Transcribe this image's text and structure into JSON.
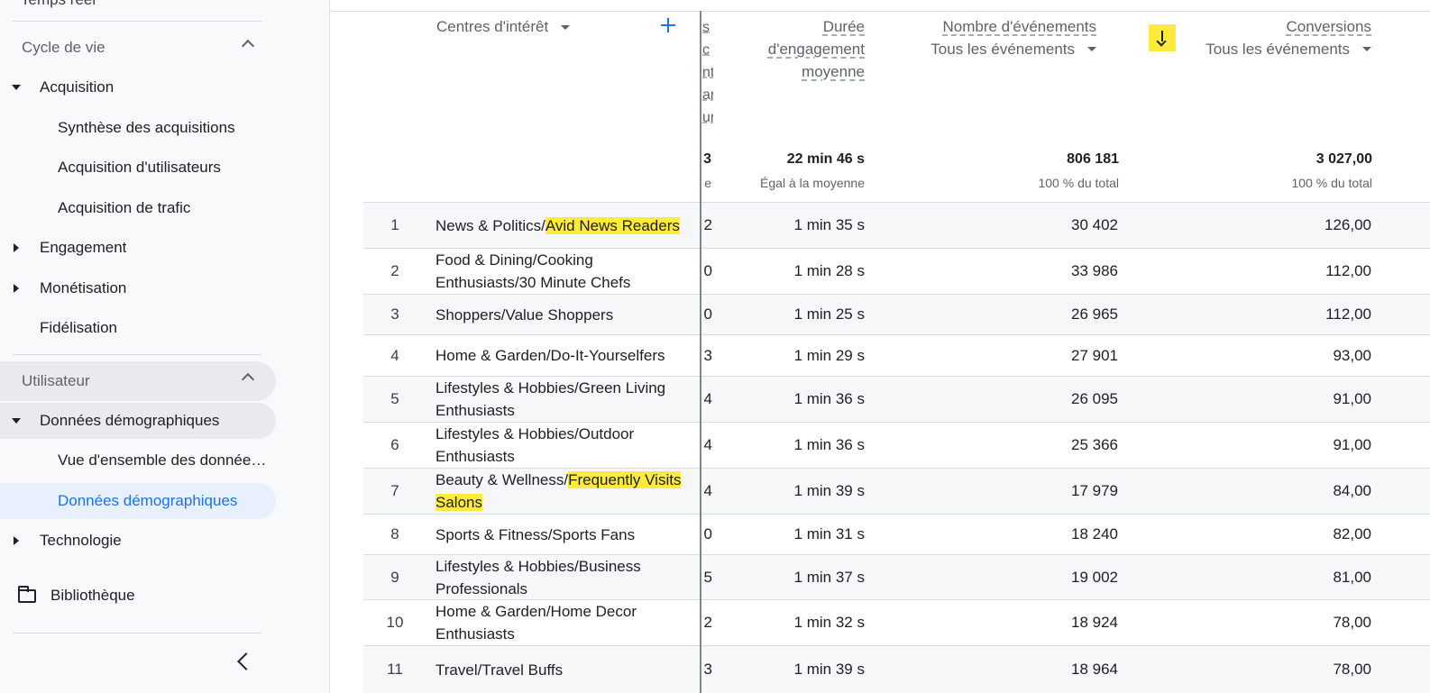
{
  "sidebar": {
    "cut_top_label": "Temps réel",
    "section_lifecycle": "Cycle de vie",
    "acquisition": "Acquisition",
    "acq_overview": "Synthèse des acquisitions",
    "acq_users": "Acquisition d'utilisateurs",
    "acq_traffic": "Acquisition de trafic",
    "engagement": "Engagement",
    "monetization": "Monétisation",
    "retention": "Fidélisation",
    "section_user": "Utilisateur",
    "demographics": "Données démographiques",
    "demo_overview": "Vue d'ensemble des données démographiques",
    "demo_details": "Données démographiques",
    "technology": "Technologie",
    "library": "Bibliothèque"
  },
  "table": {
    "dimension_header": "Centres d'intérêt",
    "cut_header": [
      "s",
      "c",
      "nt",
      "ar",
      "ur"
    ],
    "eng_header": [
      "Durée",
      "d'engagement",
      "moyenne"
    ],
    "events_header": "Nombre d'événements",
    "events_filter": "Tous les événements",
    "conv_header": "Conversions",
    "conv_filter": "Tous les événements",
    "totals": {
      "cut": "3",
      "cut_sub": "e",
      "eng": "22 min 46 s",
      "eng_sub": "Égal à la moyenne",
      "events": "806 181",
      "events_sub": "100 % du total",
      "conv": "3 027,00",
      "conv_sub": "100 % du total"
    },
    "rows": [
      {
        "idx": "1",
        "name": "News & Politics/",
        "hl": "Avid News Readers",
        "cut": "2",
        "eng": "1 min 35 s",
        "events": "30 402",
        "conv": "126,00"
      },
      {
        "idx": "2",
        "name": "Food & Dining/Cooking Enthusiasts/30 Minute Chefs",
        "hl": "",
        "cut": "0",
        "eng": "1 min 28 s",
        "events": "33 986",
        "conv": "112,00"
      },
      {
        "idx": "3",
        "name": "Shoppers/Value Shoppers",
        "hl": "",
        "cut": "0",
        "eng": "1 min 25 s",
        "events": "26 965",
        "conv": "112,00"
      },
      {
        "idx": "4",
        "name": "Home & Garden/Do-It-Yourselfers",
        "hl": "",
        "cut": "3",
        "eng": "1 min 29 s",
        "events": "27 901",
        "conv": "93,00"
      },
      {
        "idx": "5",
        "name": "Lifestyles & Hobbies/Green Living Enthusiasts",
        "hl": "",
        "cut": "4",
        "eng": "1 min 36 s",
        "events": "26 095",
        "conv": "91,00"
      },
      {
        "idx": "6",
        "name": "Lifestyles & Hobbies/Outdoor Enthusiasts",
        "hl": "",
        "cut": "4",
        "eng": "1 min 36 s",
        "events": "25 366",
        "conv": "91,00"
      },
      {
        "idx": "7",
        "name": "Beauty & Wellness/",
        "hl": "Frequently Visits Salons",
        "cut": "4",
        "eng": "1 min 39 s",
        "events": "17 979",
        "conv": "84,00"
      },
      {
        "idx": "8",
        "name": "Sports & Fitness/Sports Fans",
        "hl": "",
        "cut": "0",
        "eng": "1 min 31 s",
        "events": "18 240",
        "conv": "82,00"
      },
      {
        "idx": "9",
        "name": "Lifestyles & Hobbies/Business Professionals",
        "hl": "",
        "cut": "5",
        "eng": "1 min 37 s",
        "events": "19 002",
        "conv": "81,00"
      },
      {
        "idx": "10",
        "name": "Home & Garden/Home Decor Enthusiasts",
        "hl": "",
        "cut": "2",
        "eng": "1 min 32 s",
        "events": "18 924",
        "conv": "78,00"
      },
      {
        "idx": "11",
        "name": "Travel/Travel Buffs",
        "hl": "",
        "cut": "3",
        "eng": "1 min 39 s",
        "events": "18 964",
        "conv": "78,00"
      }
    ]
  }
}
